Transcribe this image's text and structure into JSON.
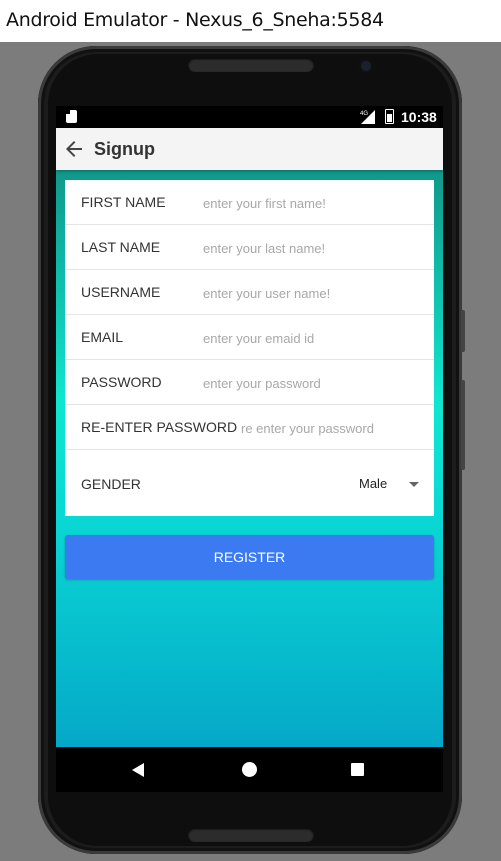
{
  "window": {
    "title": "Android Emulator - Nexus_6_Sneha:5584"
  },
  "statusbar": {
    "time": "10:38",
    "network": "4G"
  },
  "appbar": {
    "title": "Signup"
  },
  "form": {
    "fields": [
      {
        "label": "FIRST NAME",
        "value": "",
        "placeholder": "enter your first name!"
      },
      {
        "label": "LAST NAME",
        "value": "",
        "placeholder": "enter your last name!"
      },
      {
        "label": "USERNAME",
        "value": "",
        "placeholder": "enter your user name!"
      },
      {
        "label": "EMAIL",
        "value": "",
        "placeholder": "enter your emaid id"
      },
      {
        "label": "PASSWORD",
        "value": "",
        "placeholder": "enter your password"
      },
      {
        "label": "RE-ENTER PASSWORD",
        "value": "",
        "placeholder": "re enter your password"
      }
    ],
    "gender": {
      "label": "GENDER",
      "selected": "Male"
    }
  },
  "register_button": {
    "label": "REGISTER"
  },
  "colors": {
    "button": "#3b7af0",
    "gradient_top": "#10988a",
    "gradient_mid": "#10e6cf",
    "gradient_bottom": "#05a8c8"
  },
  "icons": {
    "back": "arrow-left-icon",
    "nav_back": "triangle-back-icon",
    "nav_home": "circle-home-icon",
    "nav_recents": "square-recents-icon"
  }
}
